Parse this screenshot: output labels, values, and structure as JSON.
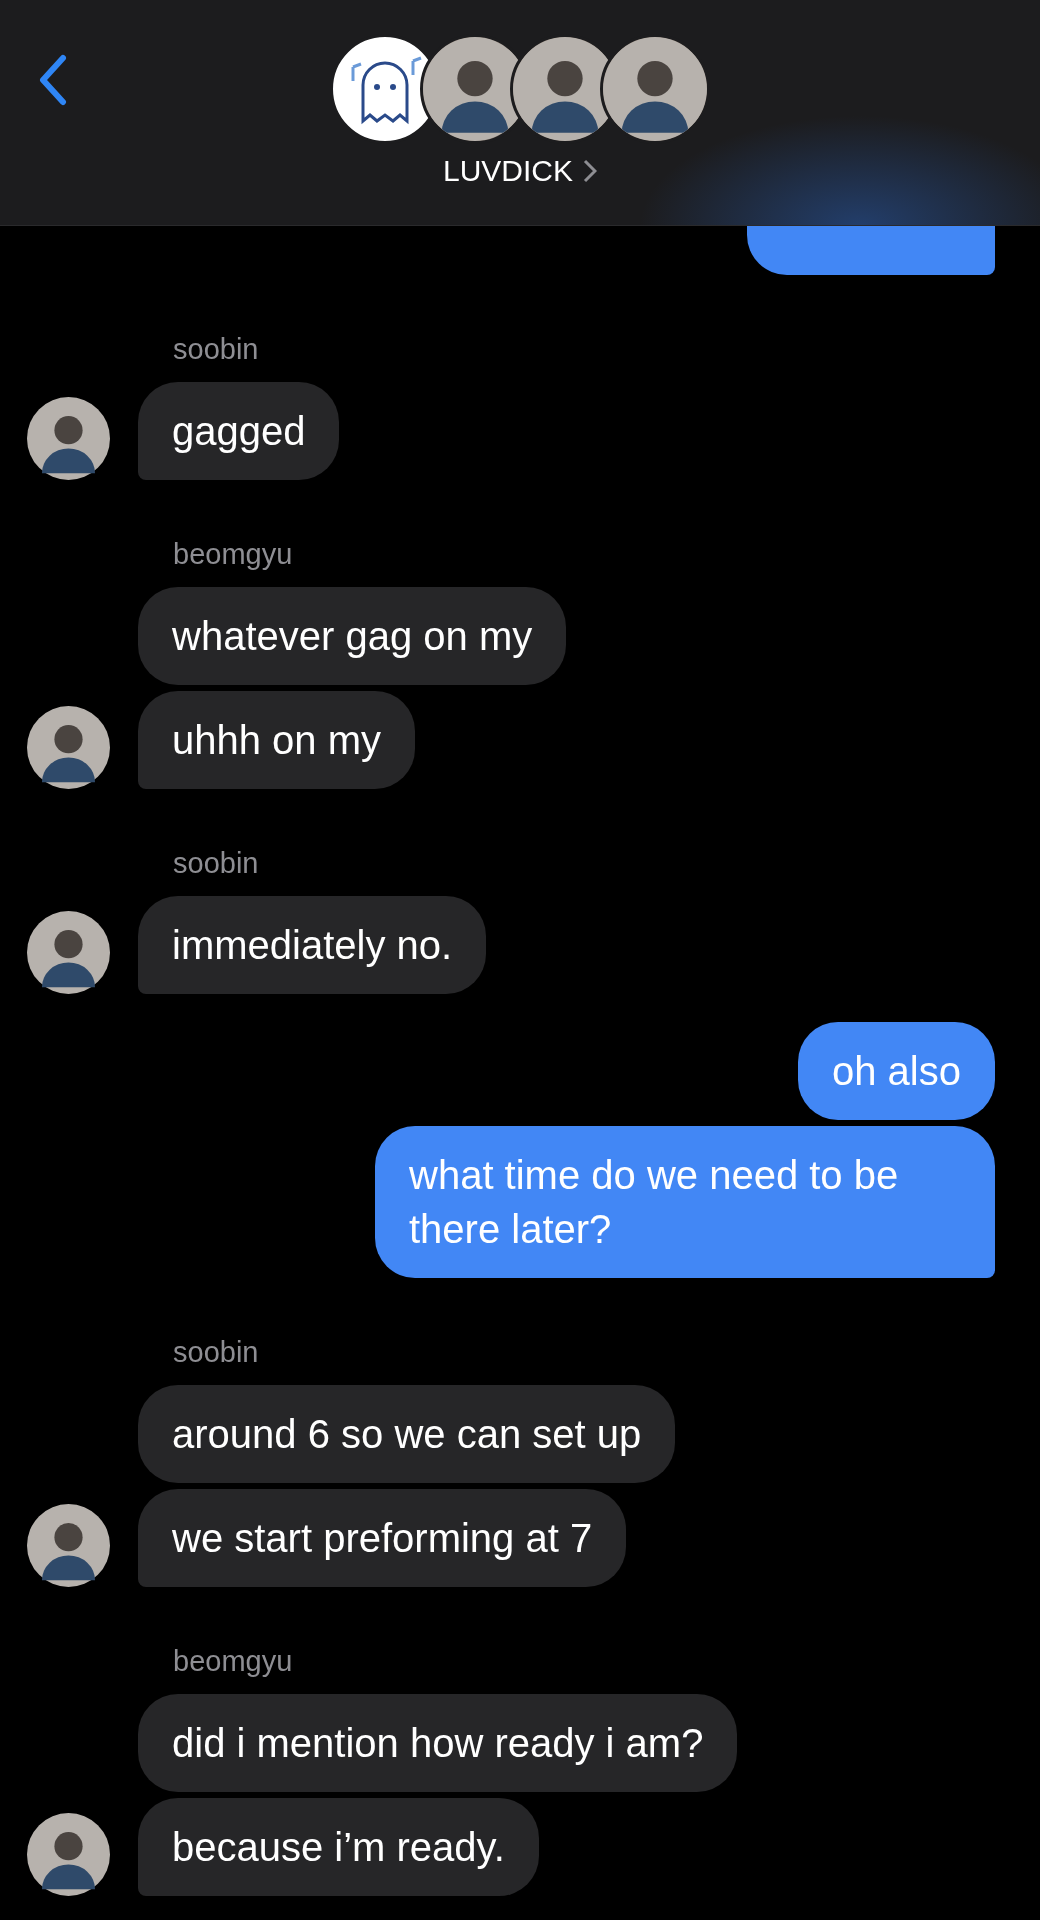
{
  "header": {
    "title": "LUVDICK",
    "avatars": [
      {
        "kind": "ghost"
      },
      {
        "kind": "picture"
      },
      {
        "kind": "picture"
      },
      {
        "kind": "picture"
      }
    ]
  },
  "messages": [
    {
      "kind": "outgoing",
      "cut": true
    },
    {
      "kind": "incoming",
      "sender": "soobin",
      "texts": [
        "gagged"
      ]
    },
    {
      "kind": "incoming",
      "sender": "beomgyu",
      "texts": [
        "whatever gag on my",
        "uhhh on my"
      ]
    },
    {
      "kind": "incoming",
      "sender": "soobin",
      "texts": [
        "immediately no."
      ]
    },
    {
      "kind": "outgoing",
      "texts": [
        "oh also",
        "what time do we need to be there later?"
      ]
    },
    {
      "kind": "incoming",
      "sender": "soobin",
      "texts": [
        "around 6 so we can set up",
        "we start preforming at 7"
      ]
    },
    {
      "kind": "incoming",
      "sender": "beomgyu",
      "texts": [
        "did i mention how ready i am?",
        "because i’m ready."
      ]
    }
  ]
}
